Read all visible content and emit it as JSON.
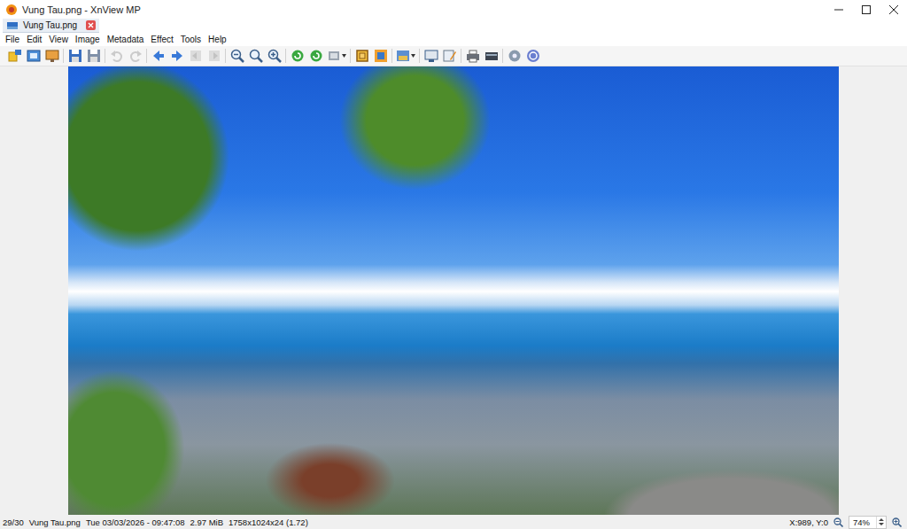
{
  "window": {
    "title": "Vung Tau.png - XnView MP"
  },
  "tabs": [
    {
      "label": "Vung Tau.png",
      "selected": true
    }
  ],
  "menu": [
    "File",
    "Edit",
    "View",
    "Image",
    "Metadata",
    "Effect",
    "Tools",
    "Help"
  ],
  "toolbar": [
    {
      "kind": "browser",
      "disabled": false
    },
    {
      "kind": "fullscreen",
      "disabled": false
    },
    {
      "kind": "slideshow",
      "disabled": false
    },
    {
      "kind": "separator",
      "disabled": false
    },
    {
      "kind": "save",
      "disabled": false
    },
    {
      "kind": "saveas",
      "disabled": false
    },
    {
      "kind": "separator",
      "disabled": false
    },
    {
      "kind": "undo",
      "disabled": true
    },
    {
      "kind": "redo",
      "disabled": true
    },
    {
      "kind": "separator",
      "disabled": false
    },
    {
      "kind": "prev",
      "disabled": false
    },
    {
      "kind": "next",
      "disabled": false
    },
    {
      "kind": "first",
      "disabled": true
    },
    {
      "kind": "last",
      "disabled": true
    },
    {
      "kind": "separator",
      "disabled": false
    },
    {
      "kind": "zoomout",
      "disabled": false
    },
    {
      "kind": "zoomfit",
      "disabled": false
    },
    {
      "kind": "zoomin",
      "disabled": false
    },
    {
      "kind": "separator",
      "disabled": false
    },
    {
      "kind": "rotleft",
      "disabled": false
    },
    {
      "kind": "rotright",
      "disabled": false
    },
    {
      "kind": "rotmenu",
      "disabled": false
    },
    {
      "kind": "separator",
      "disabled": false
    },
    {
      "kind": "crop",
      "disabled": false
    },
    {
      "kind": "resize",
      "disabled": false
    },
    {
      "kind": "separator",
      "disabled": false
    },
    {
      "kind": "adjust",
      "disabled": false
    },
    {
      "kind": "separator",
      "disabled": false
    },
    {
      "kind": "capture",
      "disabled": false
    },
    {
      "kind": "edit",
      "disabled": false
    },
    {
      "kind": "separator",
      "disabled": false
    },
    {
      "kind": "print",
      "disabled": false
    },
    {
      "kind": "scan",
      "disabled": false
    },
    {
      "kind": "separator",
      "disabled": false
    },
    {
      "kind": "settings",
      "disabled": false
    },
    {
      "kind": "help",
      "disabled": false
    }
  ],
  "status_bar": {
    "position": "29/30",
    "filename": "Vung Tau.png",
    "date": "Tue 03/03/2026 - 09:47:08",
    "size": "2.97 MiB",
    "dimensions": "1758x1024x24 (1.72)",
    "cursor": "X:989, Y:0",
    "zoom": "74%"
  }
}
